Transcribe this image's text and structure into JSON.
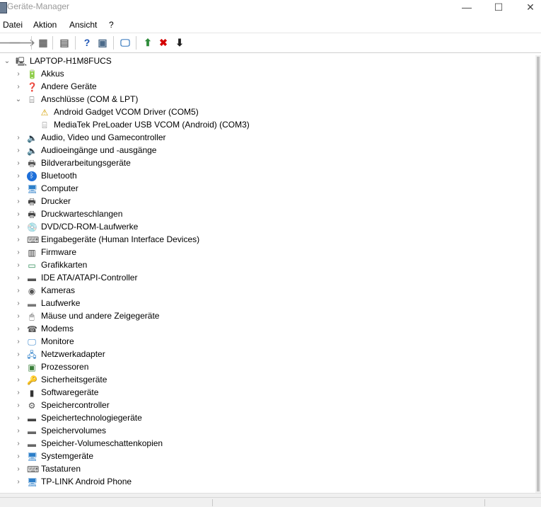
{
  "window": {
    "title": "Geräte-Manager",
    "minimize": "—",
    "maximize": "☐",
    "close": "✕"
  },
  "menubar": [
    "Datei",
    "Aktion",
    "Ansicht",
    "?"
  ],
  "toolbar": [
    {
      "name": "back-icon",
      "glyph": "🡐",
      "color": "#8a8a8a"
    },
    {
      "name": "forward-icon",
      "glyph": "🡒",
      "color": "#8a8a8a"
    },
    {
      "name": "show-hide-console-tree-icon",
      "glyph": "▦",
      "color": "#6b6b6b"
    },
    {
      "name": "properties-icon",
      "glyph": "▤",
      "color": "#6b6b6b"
    },
    {
      "name": "help-icon",
      "glyph": "?",
      "color": "#1d55b5"
    },
    {
      "name": "action-pane-icon",
      "glyph": "▣",
      "color": "#4c6b8a"
    },
    {
      "name": "scan-hardware-icon",
      "glyph": "🖵",
      "color": "#3a7bbf"
    },
    {
      "name": "update-driver-icon",
      "glyph": "⬆",
      "color": "#2e8b3a"
    },
    {
      "name": "uninstall-device-icon",
      "glyph": "✖",
      "color": "#d40000"
    },
    {
      "name": "disable-device-icon",
      "glyph": "⬇",
      "color": "#222222"
    }
  ],
  "tree": {
    "root": "LAPTOP-H1M8FUCS",
    "items": [
      {
        "label": "Akkus",
        "icon": "battery-icon",
        "glyph": "🔋",
        "color": "#3a9b3a",
        "expanded": false,
        "level": 1
      },
      {
        "label": "Andere Geräte",
        "icon": "unknown-device-icon",
        "glyph": "❓",
        "color": "#666",
        "expanded": false,
        "level": 1
      },
      {
        "label": "Anschlüsse (COM & LPT)",
        "icon": "port-icon",
        "glyph": "⌸",
        "color": "#555",
        "expanded": true,
        "level": 1
      },
      {
        "label": "Android Gadget VCOM Driver (COM5)",
        "icon": "warning-icon",
        "glyph": "⚠",
        "color": "#d4a000",
        "level": 2
      },
      {
        "label": "MediaTek PreLoader USB VCOM (Android) (COM3)",
        "icon": "port-icon",
        "glyph": "⌸",
        "color": "#777",
        "level": 2
      },
      {
        "label": "Audio, Video und Gamecontroller",
        "icon": "speaker-icon",
        "glyph": "🔈",
        "color": "#666",
        "expanded": false,
        "level": 1
      },
      {
        "label": "Audioeingänge und -ausgänge",
        "icon": "speaker-icon",
        "glyph": "🔈",
        "color": "#666",
        "expanded": false,
        "level": 1
      },
      {
        "label": "Bildverarbeitungsgeräte",
        "icon": "scanner-icon",
        "glyph": "🖶",
        "color": "#555",
        "expanded": false,
        "level": 1
      },
      {
        "label": "Bluetooth",
        "icon": "bluetooth-icon",
        "glyph": "ᛒ",
        "color": "#fff",
        "bg": "#1e6fd9",
        "expanded": false,
        "level": 1
      },
      {
        "label": "Computer",
        "icon": "computer-icon",
        "glyph": "🖥",
        "color": "#2d7fc9",
        "expanded": false,
        "level": 1
      },
      {
        "label": "Drucker",
        "icon": "printer-icon",
        "glyph": "🖶",
        "color": "#444",
        "expanded": false,
        "level": 1
      },
      {
        "label": "Druckwarteschlangen",
        "icon": "print-queue-icon",
        "glyph": "🖶",
        "color": "#444",
        "expanded": false,
        "level": 1
      },
      {
        "label": "DVD/CD-ROM-Laufwerke",
        "icon": "dvd-drive-icon",
        "glyph": "💿",
        "color": "#777",
        "expanded": false,
        "level": 1
      },
      {
        "label": "Eingabegeräte (Human Interface Devices)",
        "icon": "hid-icon",
        "glyph": "⌨",
        "color": "#555",
        "expanded": false,
        "level": 1
      },
      {
        "label": "Firmware",
        "icon": "firmware-icon",
        "glyph": "▥",
        "color": "#333",
        "expanded": false,
        "level": 1
      },
      {
        "label": "Grafikkarten",
        "icon": "display-adapter-icon",
        "glyph": "▭",
        "color": "#2e8b57",
        "expanded": false,
        "level": 1
      },
      {
        "label": "IDE ATA/ATAPI-Controller",
        "icon": "ide-controller-icon",
        "glyph": "▬",
        "color": "#555",
        "expanded": false,
        "level": 1
      },
      {
        "label": "Kameras",
        "icon": "camera-icon",
        "glyph": "◉",
        "color": "#555",
        "expanded": false,
        "level": 1
      },
      {
        "label": "Laufwerke",
        "icon": "disk-drive-icon",
        "glyph": "▬",
        "color": "#777",
        "expanded": false,
        "level": 1
      },
      {
        "label": "Mäuse und andere Zeigegeräte",
        "icon": "mouse-icon",
        "glyph": "🖱",
        "color": "#555",
        "expanded": false,
        "level": 1
      },
      {
        "label": "Modems",
        "icon": "modem-icon",
        "glyph": "☎",
        "color": "#555",
        "expanded": false,
        "level": 1
      },
      {
        "label": "Monitore",
        "icon": "monitor-icon",
        "glyph": "🖵",
        "color": "#2d7fc9",
        "expanded": false,
        "level": 1
      },
      {
        "label": "Netzwerkadapter",
        "icon": "network-adapter-icon",
        "glyph": "🖧",
        "color": "#2d7fc9",
        "expanded": false,
        "level": 1
      },
      {
        "label": "Prozessoren",
        "icon": "processor-icon",
        "glyph": "▣",
        "color": "#3a7f3a",
        "expanded": false,
        "level": 1
      },
      {
        "label": "Sicherheitsgeräte",
        "icon": "security-device-icon",
        "glyph": "🔑",
        "color": "#c59a1a",
        "expanded": false,
        "level": 1
      },
      {
        "label": "Softwaregeräte",
        "icon": "software-device-icon",
        "glyph": "▮",
        "color": "#333",
        "expanded": false,
        "level": 1
      },
      {
        "label": "Speichercontroller",
        "icon": "storage-controller-icon",
        "glyph": "⚙",
        "color": "#555",
        "expanded": false,
        "level": 1
      },
      {
        "label": "Speichertechnologiegeräte",
        "icon": "storage-tech-icon",
        "glyph": "▬",
        "color": "#444",
        "expanded": false,
        "level": 1
      },
      {
        "label": "Speichervolumes",
        "icon": "storage-volume-icon",
        "glyph": "▬",
        "color": "#666",
        "expanded": false,
        "level": 1
      },
      {
        "label": "Speicher-Volumeschattenkopien",
        "icon": "shadow-copy-icon",
        "glyph": "▬",
        "color": "#666",
        "expanded": false,
        "level": 1
      },
      {
        "label": "Systemgeräte",
        "icon": "system-device-icon",
        "glyph": "🖥",
        "color": "#2d7fc9",
        "expanded": false,
        "level": 1
      },
      {
        "label": "Tastaturen",
        "icon": "keyboard-icon",
        "glyph": "⌨",
        "color": "#555",
        "expanded": false,
        "level": 1
      },
      {
        "label": "TP-LINK Android Phone",
        "icon": "phone-icon",
        "glyph": "🖥",
        "color": "#2d7fc9",
        "expanded": false,
        "level": 1
      },
      {
        "label": "",
        "icon": "usb-controller-icon",
        "glyph": "▬",
        "color": "#555",
        "expanded": false,
        "level": 1
      }
    ]
  }
}
